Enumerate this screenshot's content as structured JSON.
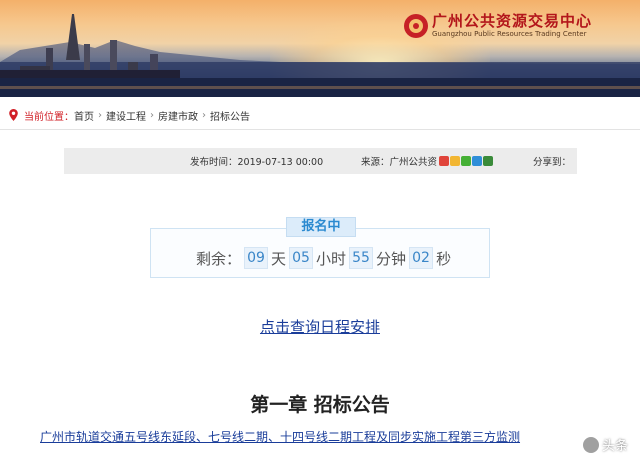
{
  "banner": {
    "logo_cn": "广州公共资源交易中心",
    "logo_en": "Guangzhou Public Resources Trading Center"
  },
  "breadcrumb": {
    "label": "当前位置：",
    "items": [
      "首页",
      "建设工程",
      "房建市政",
      "招标公告"
    ]
  },
  "info": {
    "date": "发布时间：2019-07-13 00:00",
    "source": "来源：广州公共资",
    "share": "分享到："
  },
  "countdown": {
    "status": "报名中",
    "prefix": "剩余：",
    "days": "09",
    "days_unit": "天",
    "hours": "05",
    "hours_unit": "小时",
    "minutes": "55",
    "minutes_unit": "分钟",
    "seconds": "02",
    "seconds_unit": "秒"
  },
  "schedule_link": "点击查询日程安排",
  "chapter_title": "第一章 招标公告",
  "announcement": "广州市轨道交通五号线东延段、七号线二期、十四号线二期工程及同步实施工程第三方监测",
  "watermark": "头条"
}
